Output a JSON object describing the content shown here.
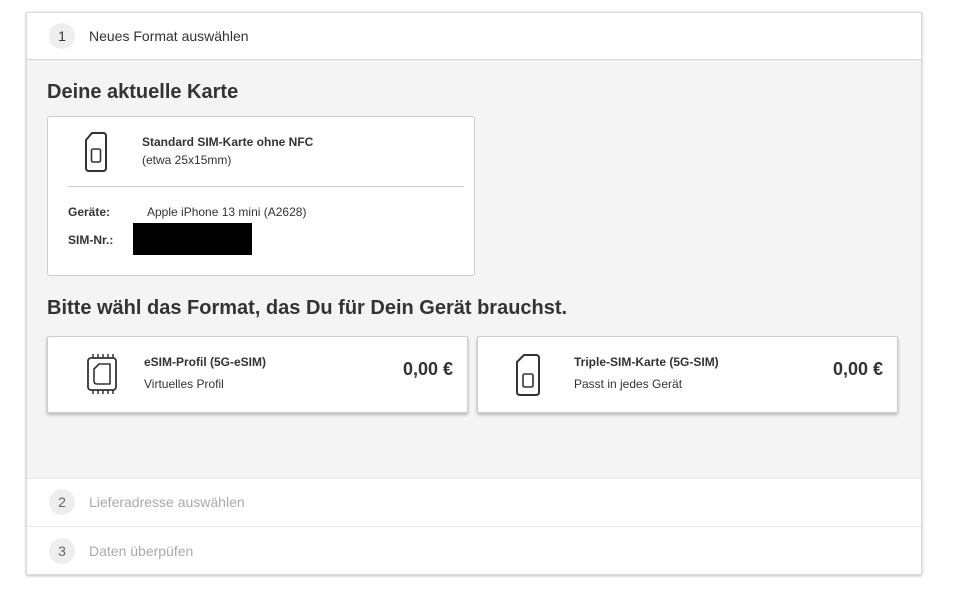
{
  "steps": [
    {
      "number": "1",
      "label": "Neues Format auswählen"
    },
    {
      "number": "2",
      "label": "Lieferadresse auswählen"
    },
    {
      "number": "3",
      "label": "Daten überpüfen"
    }
  ],
  "current_card": {
    "heading": "Deine aktuelle Karte",
    "icon": "sim-card-icon",
    "name": "Standard SIM-Karte ohne NFC",
    "size": "(etwa 25x15mm)",
    "device_label": "Geräte:",
    "device_value": "Apple iPhone 13 mini (A2628)",
    "sim_label": "SIM-Nr.:"
  },
  "format_prompt": "Bitte wähl das Format, das Du für Dein Gerät brauchst.",
  "options": [
    {
      "icon": "esim-chip-icon",
      "title": "eSIM-Profil (5G-eSIM)",
      "subtitle": "Virtuelles Profil",
      "price": "0,00 €"
    },
    {
      "icon": "sim-card-icon",
      "title": "Triple-SIM-Karte (5G-SIM)",
      "subtitle": "Passt in jedes Gerät",
      "price": "0,00 €"
    }
  ],
  "colors": {
    "panel_background": "#f4f4f4",
    "text": "#333333",
    "inactive_text": "#aaaaaa",
    "step_circle": "#eeeeee",
    "redaction": "#000000"
  }
}
